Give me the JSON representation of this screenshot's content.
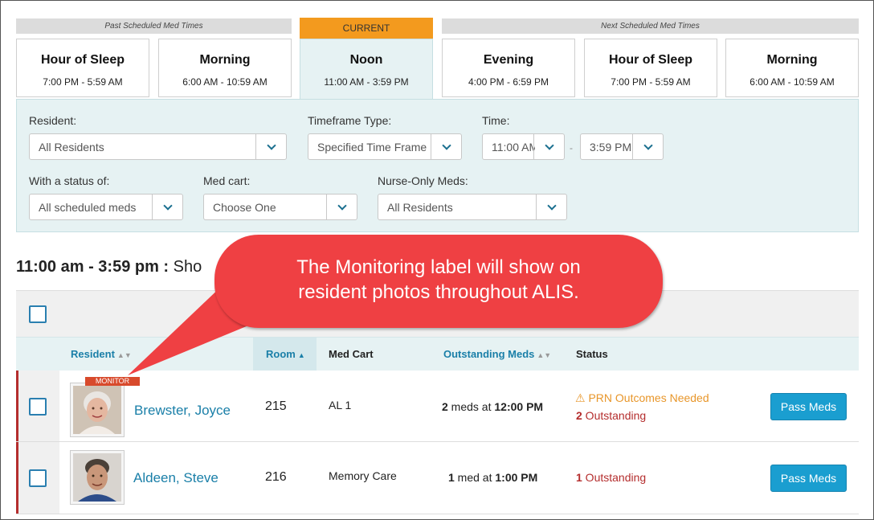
{
  "tabs": {
    "past_label": "Past Scheduled Med Times",
    "current_label": "CURRENT",
    "next_label": "Next Scheduled Med Times",
    "items": [
      {
        "name": "Hour of Sleep",
        "time": "7:00 PM - 5:59 AM"
      },
      {
        "name": "Morning",
        "time": "6:00 AM - 10:59 AM"
      },
      {
        "name": "Noon",
        "time": "11:00 AM - 3:59 PM"
      },
      {
        "name": "Evening",
        "time": "4:00 PM - 6:59 PM"
      },
      {
        "name": "Hour of Sleep",
        "time": "7:00 PM - 5:59 AM"
      },
      {
        "name": "Morning",
        "time": "6:00 AM - 10:59 AM"
      }
    ]
  },
  "filters": {
    "resident_label": "Resident:",
    "resident_value": "All Residents",
    "timeframe_label": "Timeframe Type:",
    "timeframe_value": "Specified Time Frame",
    "time_label": "Time:",
    "time_from": "11:00 AM",
    "time_sep": "-",
    "time_to": "3:59 PM",
    "status_label": "With a status of:",
    "status_value": "All scheduled meds",
    "medcart_label": "Med cart:",
    "medcart_value": "Choose One",
    "nurse_label": "Nurse-Only Meds:",
    "nurse_value": "All Residents"
  },
  "range": {
    "bold": "11:00 am - 3:59 pm :",
    "rest": " Sho"
  },
  "table": {
    "headers": {
      "resident": "Resident",
      "room": "Room",
      "medcart": "Med Cart",
      "outstanding": "Outstanding Meds",
      "status": "Status"
    },
    "rows": [
      {
        "monitor": "MONITOR",
        "name": "Brewster, Joyce",
        "room": "215",
        "medcart": "AL 1",
        "meds_count": "2",
        "meds_text": " meds at ",
        "meds_time": "12:00 PM",
        "warn": "PRN Outcomes Needed",
        "out_count": "2",
        "out_text": " Outstanding",
        "button": "Pass Meds"
      },
      {
        "name": "Aldeen, Steve",
        "room": "216",
        "medcart": "Memory Care",
        "meds_count": "1",
        "meds_text": " med at ",
        "meds_time": "1:00 PM",
        "out_count": "1",
        "out_text": " Outstanding",
        "button": "Pass Meds"
      }
    ]
  },
  "callout": {
    "line1": "The Monitoring label will show on",
    "line2": "resident photos throughout ALIS."
  },
  "colors": {
    "accent": "#1a7fa8",
    "current_tab": "#f39a1e",
    "callout": "#ef4043",
    "alert": "#b42d2d",
    "warning": "#e8962a"
  }
}
